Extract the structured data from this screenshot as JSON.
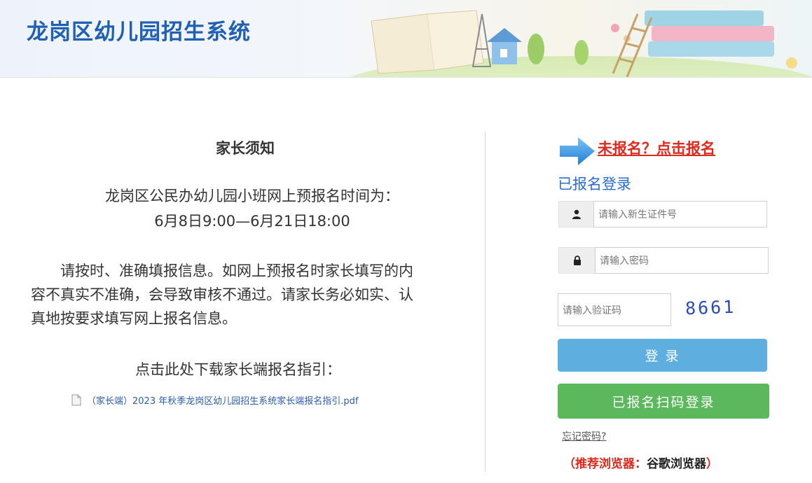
{
  "header": {
    "title": "龙岗区幼儿园招生系统"
  },
  "notice": {
    "title": "家长须知",
    "time_label": "龙岗区公民办幼儿园小班网上预报名时间为：",
    "time_range": "6月8日9:00—6月21日18:00",
    "paragraph": "请按时、准确填报信息。如网上预报名时家长填写的内容不真实不准确，会导致审核不通过。请家长务必如实、认真地按要求填写网上报名信息。",
    "download_label": "点击此处下载家长端报名指引：",
    "pdf_link": "（家长端）2023 年秋季龙岗区幼儿园招生系统家长端报名指引.pdf"
  },
  "login": {
    "signup_link": "未报名？点击报名",
    "title": "已报名登录",
    "id_placeholder": "请输入新生证件号",
    "password_placeholder": "请输入密码",
    "captcha_placeholder": "请输入验证码",
    "captcha_code": "8661",
    "login_button": "登 录",
    "scan_button": "已报名扫码登录",
    "forgot_link": "忘记密码?",
    "browser_tip_prefix": "（推荐浏览器：",
    "browser_tip_value": "谷歌浏览器",
    "browser_tip_suffix": "）"
  },
  "icons": {
    "user": "user-icon",
    "lock": "lock-icon",
    "arrow": "arrow-right-icon",
    "pdf": "document-icon"
  },
  "colors": {
    "brand_blue": "#2060b4",
    "signup_red": "#e02a1e",
    "login_blue": "#5eafe0",
    "scan_green": "#5cb85c"
  }
}
